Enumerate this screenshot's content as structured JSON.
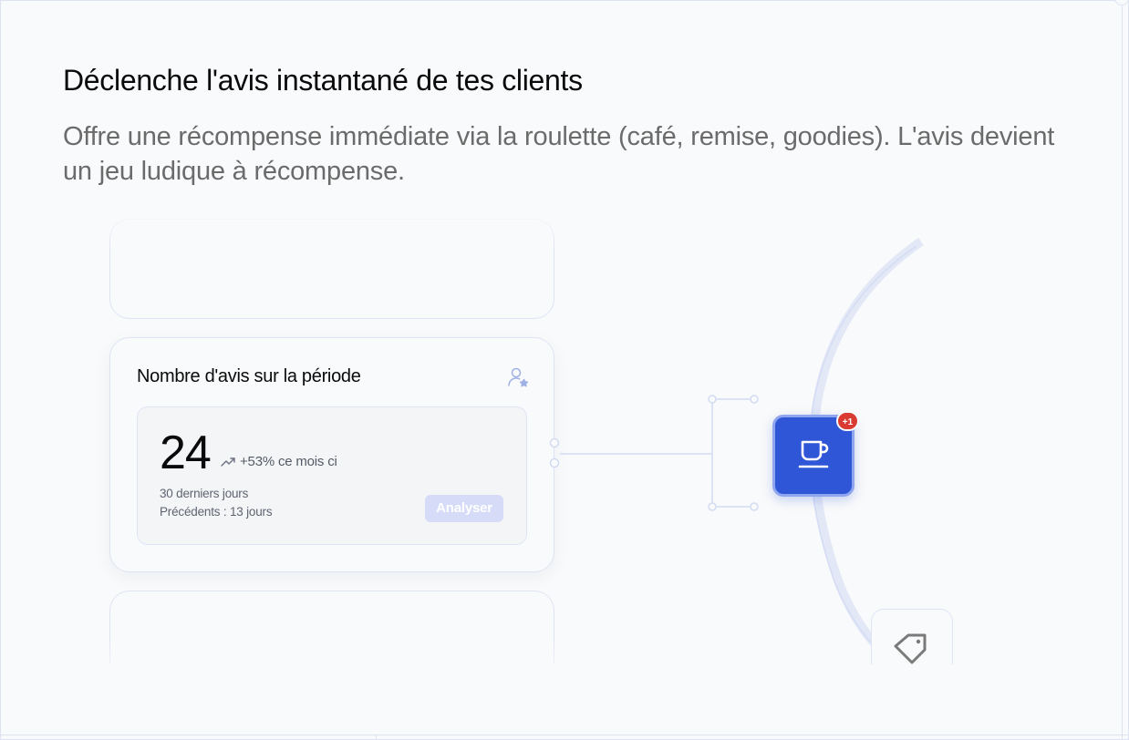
{
  "hero": {
    "title": "Déclenche l'avis instantané de tes clients",
    "subtitle": "Offre une récompense immédiate via la roulette (café, remise, goodies). L'avis devient un jeu ludique à récompense."
  },
  "stats_card": {
    "title": "Nombre d'avis sur la période",
    "icon": "user-star-icon",
    "value": "24",
    "trend_icon": "trend-up-icon",
    "trend": "+53% ce mois ci",
    "period_current": "30 derniers jours",
    "period_previous": "Précédents : 13 jours",
    "action_label": "Analyser"
  },
  "rewards": {
    "active_icon": "coffee-cup-icon",
    "badge": "+1",
    "next_icon": "price-tag-icon"
  },
  "colors": {
    "accent": "#2f56d6",
    "badge": "#d93b32",
    "button_disabled": "#d6dcf8",
    "border": "#dfe4f4"
  }
}
